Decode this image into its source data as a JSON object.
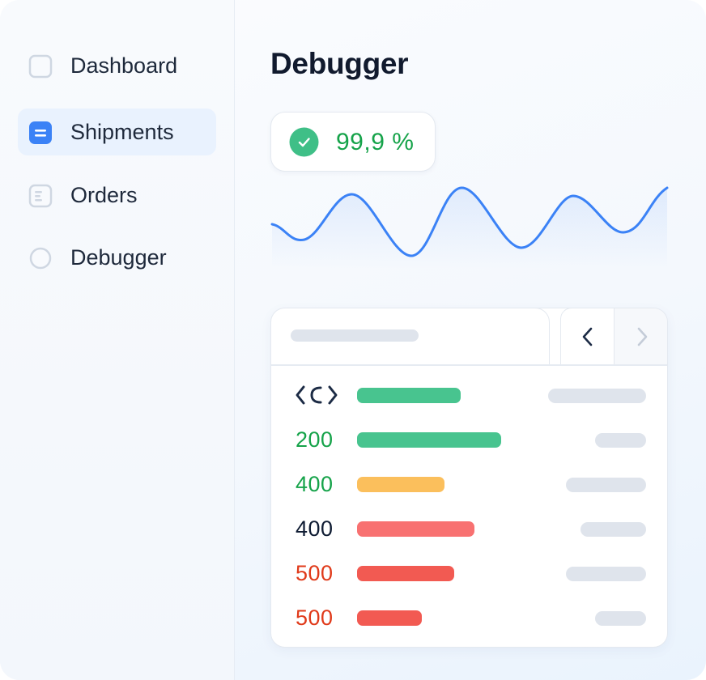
{
  "sidebar": {
    "items": [
      {
        "label": "Dashboard",
        "icon": "square-icon",
        "active": false
      },
      {
        "label": "Shipments",
        "icon": "list-icon",
        "active": true
      },
      {
        "label": "Orders",
        "icon": "document-icon",
        "active": false
      },
      {
        "label": "Debugger",
        "icon": "circle-icon",
        "active": false
      }
    ]
  },
  "main": {
    "title": "Debugger",
    "uptime": {
      "value": "99,9 %",
      "icon": "check-circle-icon"
    },
    "logs": {
      "pager": {
        "prev_icon": "chevron-left-icon",
        "next_icon": "chevron-right-icon"
      },
      "header_row": {
        "icon": "code-brackets-icon"
      },
      "rows": [
        {
          "code": "200",
          "level": 0.71
        },
        {
          "code": "400",
          "level": 0.43
        },
        {
          "code": "400",
          "level": 0.58
        },
        {
          "code": "500",
          "level": 0.48
        },
        {
          "code": "500",
          "level": 0.32
        }
      ]
    }
  },
  "colors": {
    "accent": "#3b82f6",
    "success": "#16a34a",
    "success_bar": "#48c48f",
    "warning_bar": "#fbbf5c",
    "error_light_bar": "#f87171",
    "error_bar": "#f25a52",
    "error_text": "#e03a1a",
    "neutral_text": "#0f1c33",
    "placeholder": "#dfe4ec"
  }
}
